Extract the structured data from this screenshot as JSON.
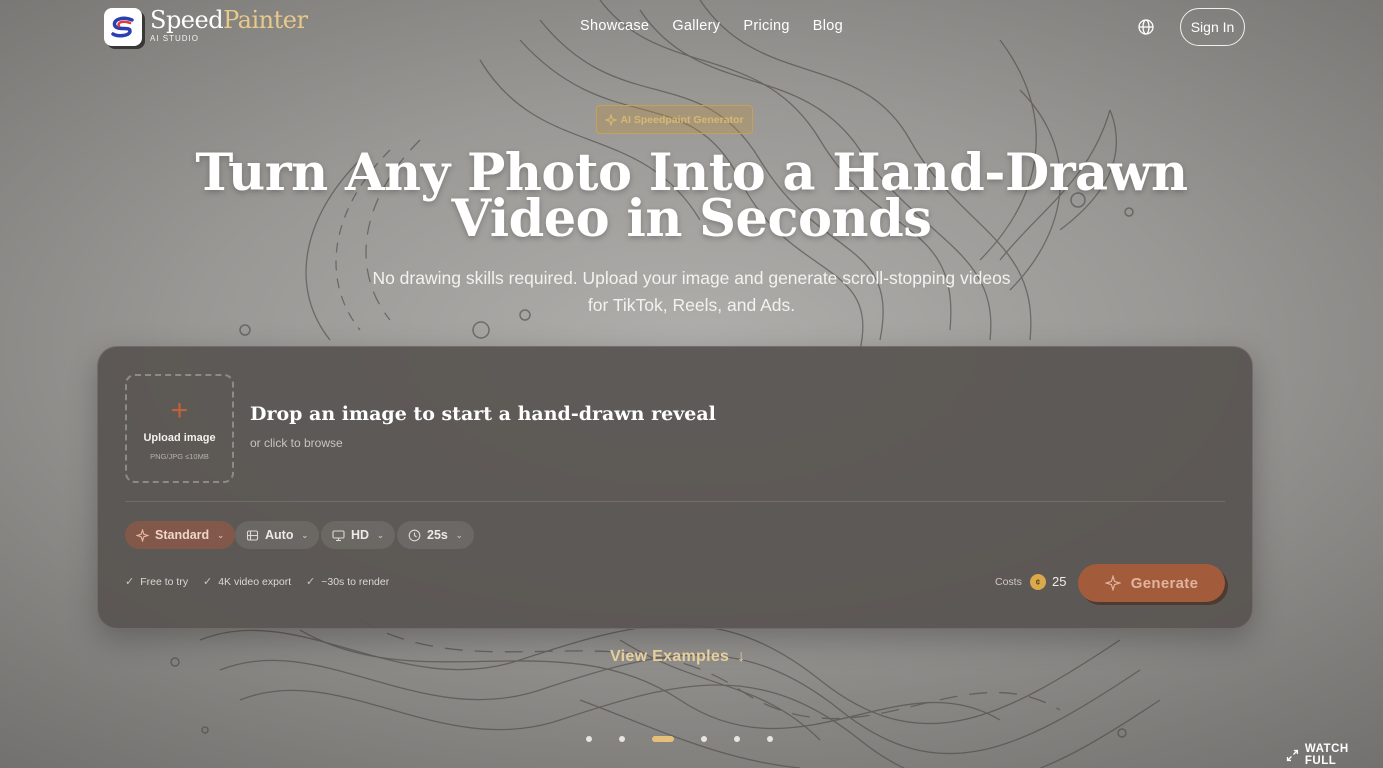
{
  "brand": {
    "name_part1": "Speed",
    "name_part2": "Painter",
    "subtitle": "AI STUDIO"
  },
  "nav": {
    "items": [
      {
        "label": "Showcase"
      },
      {
        "label": "Gallery"
      },
      {
        "label": "Pricing"
      },
      {
        "label": "Blog"
      }
    ],
    "sign_in_label": "Sign In",
    "language_icon": "globe-icon"
  },
  "hero": {
    "badge": "AI Speedpaint Generator",
    "headline_line1": "Turn Any Photo Into a Hand-Drawn",
    "headline_line2": "Video in Seconds",
    "subline": "No drawing skills required. Upload your image and generate scroll-stopping videos for TikTok, Reels, and Ads."
  },
  "upload_card": {
    "upload": {
      "label": "Upload image",
      "hint": "PNG/JPG ≤10MB"
    },
    "drop_title": "Drop an image to start a hand-drawn reveal",
    "drop_subtitle": "or click to browse",
    "options": [
      {
        "label": "Standard",
        "icon": "sparkle-icon",
        "active": true
      },
      {
        "label": "Auto",
        "icon": "aspect-ratio-icon",
        "active": false
      },
      {
        "label": "HD",
        "icon": "monitor-icon",
        "active": false
      },
      {
        "label": "25s",
        "icon": "clock-icon",
        "active": false
      }
    ],
    "features": [
      {
        "label": "Free to try"
      },
      {
        "label": "4K video export"
      },
      {
        "label": "~30s to render"
      }
    ],
    "costs_label": "Costs",
    "coin_symbol": "¢",
    "cost_value": "25",
    "generate_label": "Generate"
  },
  "view_examples": "View Examples",
  "carousel": {
    "total_slides": 6,
    "active_index": 2
  },
  "watch_full": "WATCH FULL",
  "colors": {
    "accent_gold": "#e5c07a",
    "accent_rust": "#a25b3b",
    "card_bg": "#585451"
  }
}
